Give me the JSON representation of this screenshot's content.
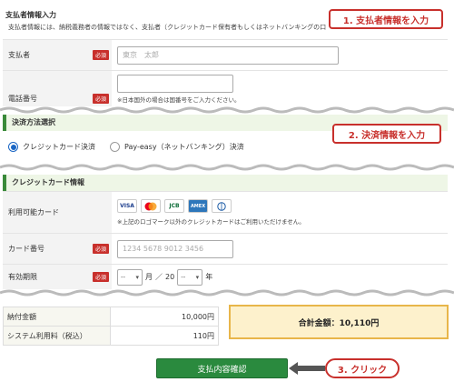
{
  "payer": {
    "heading": "支払者情報入力",
    "sub": "支払者情報には、納税義務者の情報ではなく、支払者（クレジットカード保有者もしくはネットバンキングの口",
    "name_label": "支払者",
    "name_placeholder": "東京　太郎",
    "phone_label": "電話番号",
    "phone_note": "※日本国外の場合は国番号をご入力ください。",
    "required": "必須"
  },
  "method": {
    "heading": "決済方法選択",
    "options": [
      "クレジットカード決済",
      "Pay-easy（ネットバンキング）決済"
    ],
    "selected_index": 0
  },
  "card": {
    "heading": "クレジットカード情報",
    "available_label": "利用可能カード",
    "brands": [
      "VISA",
      "MC",
      "JCB",
      "AMEX",
      "DC"
    ],
    "brand_note": "※上記のロゴマーク以外のクレジットカードはご利用いただけません。",
    "number_label": "カード番号",
    "number_placeholder": "1234 5678 9012 3456",
    "expiry_label": "有効期限",
    "month_value": "--",
    "month_unit": "月",
    "slash": "／",
    "year_prefix": "20",
    "year_value": "--",
    "year_unit": "年",
    "required": "必須"
  },
  "summary": {
    "rows": [
      {
        "label": "納付金額",
        "value": "10,000円"
      },
      {
        "label": "システム利用料（税込）",
        "value": "110円"
      }
    ],
    "total": "合計金額：10,110円"
  },
  "callouts": {
    "step1": "1. 支払者情報を入力",
    "step2": "2. 決済情報を入力",
    "step3": "3. クリック"
  },
  "confirm_button": "支払内容確認",
  "colors": {
    "accent_red": "#c8302c",
    "button_green": "#2a8a3e",
    "total_bg": "#fdf1cc"
  }
}
